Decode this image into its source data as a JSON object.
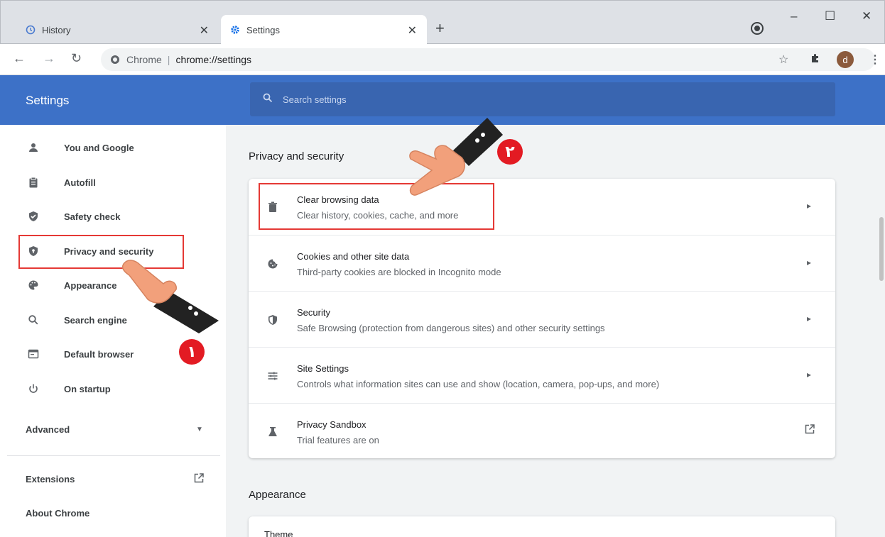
{
  "tabs": [
    {
      "label": "History",
      "icon": "history-icon"
    },
    {
      "label": "Settings",
      "icon": "gear-icon"
    }
  ],
  "toolbar": {
    "site_label": "Chrome",
    "separator": "|",
    "url": "chrome://settings",
    "avatar_letter": "d"
  },
  "header": {
    "title": "Settings",
    "search_placeholder": "Search settings"
  },
  "sidebar": {
    "items": [
      {
        "label": "You and Google",
        "icon": "person-icon"
      },
      {
        "label": "Autofill",
        "icon": "clipboard-icon"
      },
      {
        "label": "Safety check",
        "icon": "shield-check-icon"
      },
      {
        "label": "Privacy and security",
        "icon": "privacy-shield-icon"
      },
      {
        "label": "Appearance",
        "icon": "palette-icon"
      },
      {
        "label": "Search engine",
        "icon": "search-icon"
      },
      {
        "label": "Default browser",
        "icon": "browser-icon"
      },
      {
        "label": "On startup",
        "icon": "power-icon"
      }
    ],
    "advanced": "Advanced",
    "extensions": "Extensions",
    "about": "About Chrome"
  },
  "main": {
    "privacy_title": "Privacy and security",
    "rows": [
      {
        "title": "Clear browsing data",
        "subtitle": "Clear history, cookies, cache, and more",
        "icon": "trash-icon"
      },
      {
        "title": "Cookies and other site data",
        "subtitle": "Third-party cookies are blocked in Incognito mode",
        "icon": "cookie-icon"
      },
      {
        "title": "Security",
        "subtitle": "Safe Browsing (protection from dangerous sites) and other security settings",
        "icon": "security-shield-icon"
      },
      {
        "title": "Site Settings",
        "subtitle": "Controls what information sites can use and show (location, camera, pop-ups, and more)",
        "icon": "sliders-icon"
      },
      {
        "title": "Privacy Sandbox",
        "subtitle": "Trial features are on",
        "icon": "flask-icon"
      }
    ],
    "appearance_title": "Appearance",
    "theme_label": "Theme"
  },
  "annotations": {
    "badge_1": "١",
    "badge_2": "٢",
    "highlight_color": "#e53935",
    "badge_color": "#e31b23"
  },
  "colors": {
    "header_blue": "#3d71c7",
    "search_blue": "#3965b0"
  }
}
